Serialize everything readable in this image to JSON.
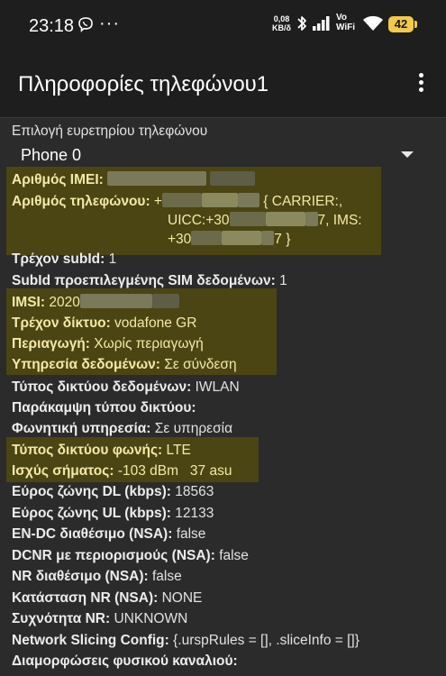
{
  "status_bar": {
    "time": "23:18",
    "more": "···",
    "speed_value": "0,08",
    "speed_unit": "KB/δ",
    "vowifi_top": "Vo",
    "vowifi_bottom": "WiFi",
    "battery": "42"
  },
  "app_bar": {
    "title": "Πληροφορίες τηλεφώνου1"
  },
  "phone_index": {
    "label": "Επιλογή ευρετηρίου τηλεφώνου",
    "selected": "Phone 0"
  },
  "rows": {
    "imei": {
      "label": "Αριθμός IMEI:",
      "value": ""
    },
    "phone_number": {
      "label": "Αριθμός τηλεφώνου:",
      "line1_a": "+",
      "line1_b": " { CARRIER:,",
      "line2_a": "UICC:+30",
      "line2_b": "7, IMS:",
      "line3_a": "+30",
      "line3_b": "7 }"
    },
    "sub_id": {
      "label": "Τρέχον subId:",
      "value": "1"
    },
    "default_sub": {
      "label": "SubId προεπιλεγμένης SIM δεδομένων:",
      "value": "1"
    },
    "imsi": {
      "label": "IMSI:",
      "value": "2020"
    },
    "network": {
      "label": "Τρέχον δίκτυο:",
      "value": "vodafone GR"
    },
    "roaming": {
      "label": "Περιαγωγή:",
      "value": "Χωρίς περιαγωγή"
    },
    "data_service": {
      "label": "Υπηρεσία δεδομένων:",
      "value": "Σε σύνδεση"
    },
    "data_net_type": {
      "label": "Τύπος δικτύου δεδομένων:",
      "value": "IWLAN"
    },
    "override": {
      "label": "Παράκαμψη τύπου δικτύου:",
      "value": ""
    },
    "voice_service": {
      "label": "Φωνητική υπηρεσία:",
      "value": "Σε υπηρεσία"
    },
    "voice_net_type": {
      "label": "Τύπος δικτύου φωνής:",
      "value": "LTE"
    },
    "signal": {
      "label": "Ισχύς σήματος:",
      "value": "-103 dBm   37 asu"
    },
    "dl_bw": {
      "label": "Εύρος ζώνης DL (kbps):",
      "value": "18563"
    },
    "ul_bw": {
      "label": "Εύρος ζώνης UL (kbps):",
      "value": "12133"
    },
    "endc": {
      "label": "EN-DC διαθέσιμο (NSA):",
      "value": "false"
    },
    "dcnr": {
      "label": "DCNR με περιορισμούς (NSA):",
      "value": "false"
    },
    "nr_avail": {
      "label": "NR διαθέσιμο (NSA):",
      "value": "false"
    },
    "nr_state": {
      "label": "Κατάσταση NR (NSA):",
      "value": "NONE"
    },
    "nr_freq": {
      "label": "Συχνότητα NR:",
      "value": "UNKNOWN"
    },
    "slicing": {
      "label": "Network Slicing Config:",
      "value": "{.urspRules = [], .sliceInfo = []}"
    },
    "phys_channel": {
      "label": "Διαμορφώσεις φυσικού καναλιού:",
      "value": ""
    }
  },
  "colors": {
    "background": "#2b2b2b",
    "bar": "#1e1e1e",
    "highlight": "#4b4514",
    "highlight_text": "#f3e9a6",
    "battery": "#f2c94c"
  },
  "icons": [
    "viber-icon",
    "bluetooth-icon",
    "signal-icon",
    "wifi-icon",
    "battery-icon",
    "overflow-menu-icon",
    "dropdown-arrow-icon"
  ]
}
